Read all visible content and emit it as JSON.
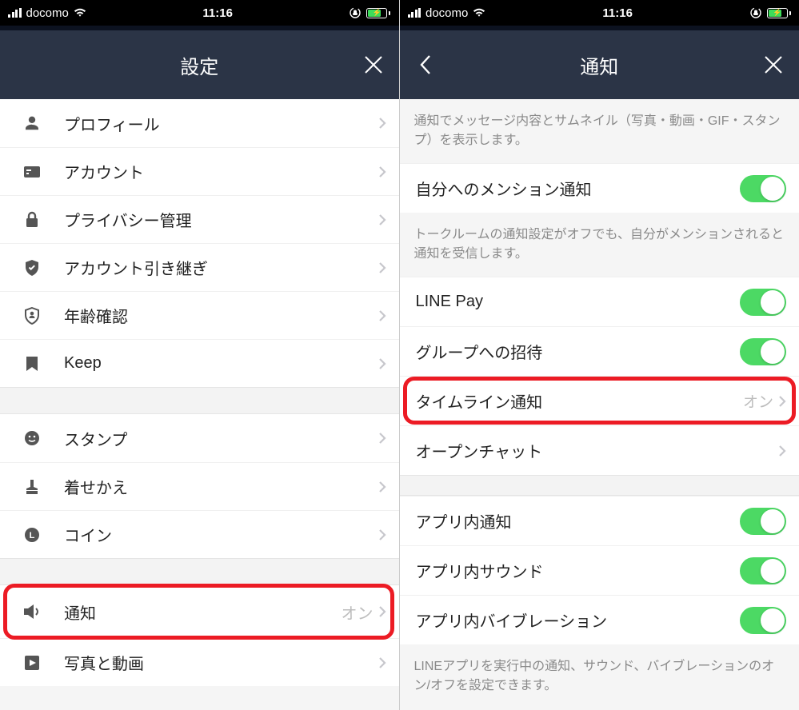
{
  "statusbar": {
    "carrier": "docomo",
    "time": "11:16"
  },
  "left": {
    "title": "設定",
    "sections": [
      {
        "rows": [
          {
            "icon": "profile-icon",
            "label": "プロフィール"
          },
          {
            "icon": "account-icon",
            "label": "アカウント"
          },
          {
            "icon": "lock-icon",
            "label": "プライバシー管理"
          },
          {
            "icon": "shield-icon",
            "label": "アカウント引き継ぎ"
          },
          {
            "icon": "age-icon",
            "label": "年齢確認"
          },
          {
            "icon": "keep-icon",
            "label": "Keep"
          }
        ]
      },
      {
        "rows": [
          {
            "icon": "sticker-icon",
            "label": "スタンプ"
          },
          {
            "icon": "theme-icon",
            "label": "着せかえ"
          },
          {
            "icon": "coin-icon",
            "label": "コイン"
          }
        ]
      },
      {
        "rows": [
          {
            "icon": "notify-icon",
            "label": "通知",
            "value": "オン",
            "highlight": true
          },
          {
            "icon": "media-icon",
            "label": "写真と動画"
          }
        ]
      }
    ]
  },
  "right": {
    "title": "通知",
    "top_desc": "通知でメッセージ内容とサムネイル（写真・動画・GIF・スタンプ）を表示します。",
    "mention": {
      "label": "自分へのメンション通知",
      "desc": "トークルームの通知設定がオフでも、自分がメンションされると通知を受信します。"
    },
    "group_toggles": [
      {
        "label": "LINE Pay",
        "on": true
      },
      {
        "label": "グループへの招待",
        "on": true
      }
    ],
    "nav_rows": [
      {
        "label": "タイムライン通知",
        "value": "オン",
        "highlight": true
      },
      {
        "label": "オープンチャット"
      }
    ],
    "inapp": [
      {
        "label": "アプリ内通知",
        "on": true
      },
      {
        "label": "アプリ内サウンド",
        "on": true
      },
      {
        "label": "アプリ内バイブレーション",
        "on": true
      }
    ],
    "inapp_desc": "LINEアプリを実行中の通知、サウンド、バイブレーションのオン/オフを設定できます。"
  }
}
